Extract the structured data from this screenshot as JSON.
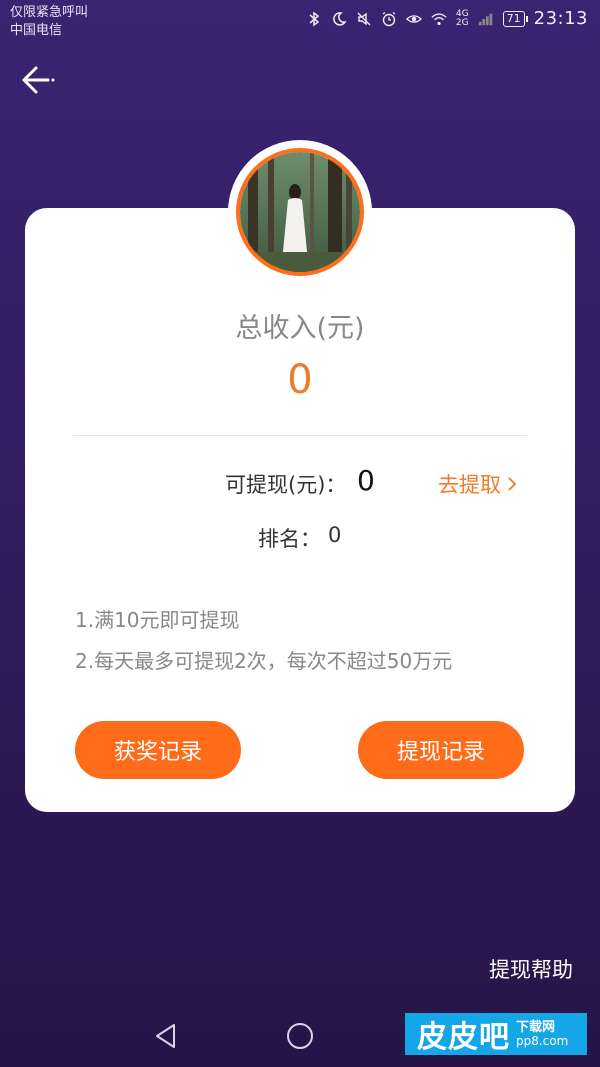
{
  "status_bar": {
    "line1": "仅限紧急呼叫",
    "line2": "中国电信",
    "battery": "71",
    "network": "4G\n2G",
    "time": "23:13",
    "icons": [
      "bluetooth-icon",
      "moon-icon",
      "mute-icon",
      "alarm-icon",
      "eye-icon",
      "wifi-icon",
      "signal-icon"
    ]
  },
  "header": {
    "back_icon": "back-arrow-icon"
  },
  "card": {
    "total_label": "总收入(元)",
    "total_value": "0",
    "withdraw_label": "可提现(元)：",
    "withdraw_value": "0",
    "go_withdraw": "去提取",
    "rank_label": "排名：",
    "rank_value": "0",
    "notes": [
      "1.满10元即可提现",
      "2.每天最多可提现2次，每次不超过50万元"
    ],
    "buttons": {
      "award_records": "获奖记录",
      "withdraw_records": "提现记录"
    }
  },
  "footer": {
    "help": "提现帮助"
  },
  "watermark": {
    "big": "皮皮吧",
    "small1": "下载网",
    "small2": "pp8.com"
  },
  "colors": {
    "accent": "#ff6c19",
    "background": "#3b2372"
  }
}
